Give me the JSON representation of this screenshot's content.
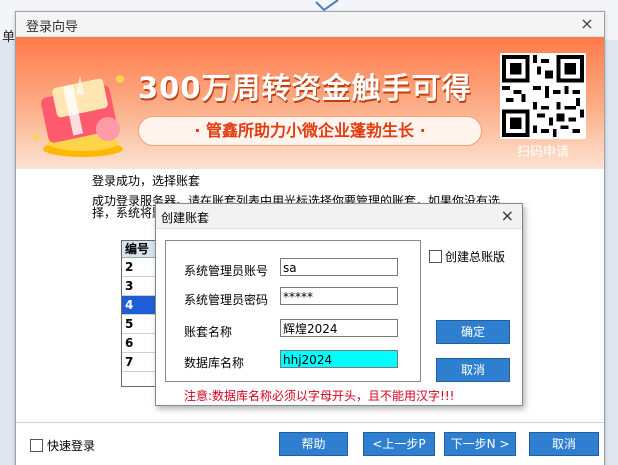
{
  "background": {
    "sidebar_label": "单"
  },
  "window": {
    "title": "登录向导",
    "close_icon": "×"
  },
  "banner": {
    "headline": "300万周转资金触手可得",
    "subline": "· 管鑫所助力小微企业蓬勃生长 ·",
    "scan_label": "扫码申请",
    "colors": {
      "top": "#ff7a4a",
      "bottom": "#fde3d2",
      "accent": "#e43b10"
    }
  },
  "main": {
    "message_line1": "登录成功，选择账套",
    "message_line2": "    成功登录服务器。请在账套列表中用光标选择你要管理的账套，如果你没有选择，系统将默认为你创建一个账套。",
    "list": {
      "header": "编号",
      "rows": [
        "2",
        "3",
        "4",
        "5",
        "6",
        "7"
      ],
      "selected": "4"
    }
  },
  "footer": {
    "quick_login_label": "快速登录",
    "quick_login_checked": false,
    "help": "帮助",
    "prev": "<上一步P",
    "next": "下一步N >",
    "cancel": "取消"
  },
  "dialog": {
    "title": "创建账套",
    "close_icon": "×",
    "fields": {
      "admin_account": {
        "label": "系统管理员账号",
        "value": "sa"
      },
      "admin_password": {
        "label": "系统管理员密码",
        "value": "*****"
      },
      "book_name": {
        "label": "账套名称",
        "value": "辉煌2024"
      },
      "db_name": {
        "label": "数据库名称",
        "value": "hhj2024"
      }
    },
    "create_master_label": "创建总账版",
    "create_master_checked": false,
    "ok": "确定",
    "cancel": "取消",
    "warning": "注意:数据库名称必须以字母开头，且不能用汉字!!!",
    "colors": {
      "warning": "#d6001c",
      "db_field_bg": "#00ffff",
      "button": "#2f7fd1"
    }
  }
}
